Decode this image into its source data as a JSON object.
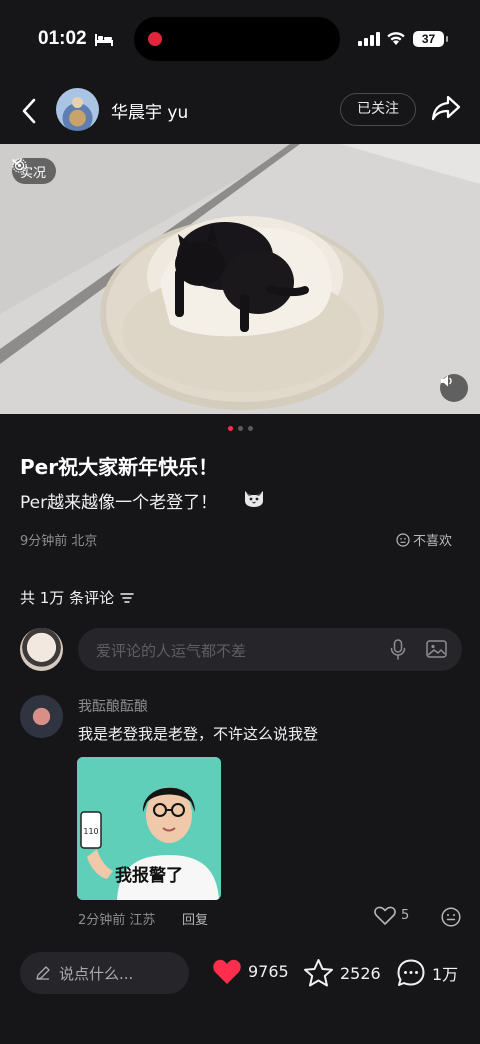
{
  "status_bar": {
    "time": "01:02",
    "battery": "37"
  },
  "header": {
    "author": "华晨宇 yu",
    "follow_label": "已关注"
  },
  "photo": {
    "live_label": "实况",
    "page_count": 3,
    "active_index": 0
  },
  "post": {
    "title": "Per祝大家新年快乐！",
    "body": "Per越来越像一个老登了！",
    "meta": "9分钟前 北京",
    "dislike_label": "不喜欢"
  },
  "comments_section": {
    "count_label": "共 1万 条评论",
    "input_placeholder": "爱评论的人运气都不差"
  },
  "comment": {
    "user": "我酝酿酝酿",
    "text": "我是老登我是老登，不许这么说我登",
    "sticker_caption": "我报警了",
    "phone_text": "110",
    "meta": "2分钟前 江苏",
    "reply_label": "回复",
    "likes": "5"
  },
  "bottom_bar": {
    "input_placeholder": "说点什么...",
    "likes": "9765",
    "favorites": "2526",
    "comments": "1万"
  },
  "colors": {
    "accent": "#ff2e4d",
    "background": "#161618",
    "input_bg": "#26262a"
  }
}
